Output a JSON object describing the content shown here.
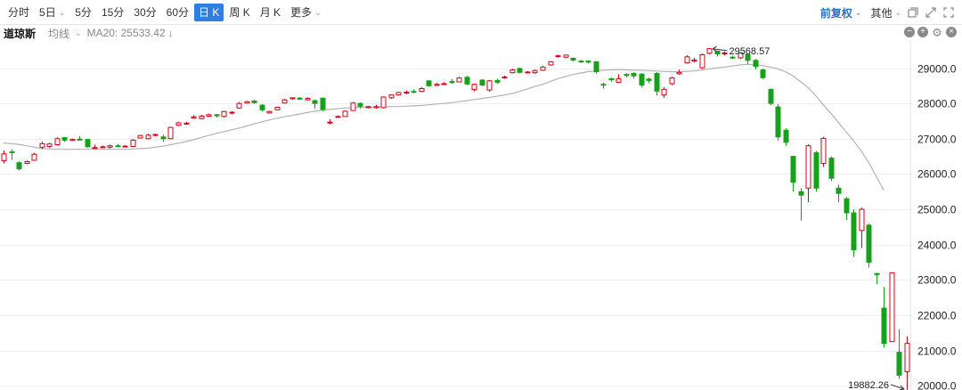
{
  "toolbar": {
    "tabs": [
      {
        "label": "分时",
        "dropdown": false,
        "active": false
      },
      {
        "label": "5日",
        "dropdown": true,
        "active": false
      },
      {
        "label": "5分",
        "dropdown": false,
        "active": false
      },
      {
        "label": "15分",
        "dropdown": false,
        "active": false
      },
      {
        "label": "30分",
        "dropdown": false,
        "active": false
      },
      {
        "label": "60分",
        "dropdown": false,
        "active": false
      },
      {
        "label": "日 K",
        "dropdown": false,
        "active": true
      },
      {
        "label": "周 K",
        "dropdown": false,
        "active": false
      },
      {
        "label": "月 K",
        "dropdown": false,
        "active": false
      },
      {
        "label": "更多",
        "dropdown": true,
        "active": false
      }
    ],
    "adjust_label": "前复权",
    "other_label": "其他"
  },
  "info": {
    "symbol": "道琼斯",
    "ma_label": "均线",
    "ma20_text": "MA20: 25533.42",
    "ma20_arrow": "↓"
  },
  "chart_data": {
    "type": "candlestick",
    "series_name": "道琼斯",
    "y_ticks": [
      "29000.0",
      "28000.0",
      "27000.0",
      "26000.0",
      "25000.0",
      "24000.0",
      "23000.0",
      "22000.0",
      "21000.0",
      "20000.0"
    ],
    "ylim": [
      19880,
      29770
    ],
    "annotations": {
      "high": "29568.57",
      "low": "19882.26"
    },
    "colors": {
      "up": "#d0021b",
      "down": "#17a01b",
      "ma": "#b3b3b3"
    },
    "candles": [
      [
        26380,
        26570,
        26670,
        26300
      ],
      [
        26630,
        26620,
        26700,
        26400
      ],
      [
        26320,
        26150,
        26360,
        26100
      ],
      [
        26300,
        26350,
        26380,
        26280
      ],
      [
        26390,
        26560,
        26600,
        26380
      ],
      [
        26760,
        26860,
        26920,
        26700
      ],
      [
        26780,
        26850,
        26880,
        26740
      ],
      [
        26830,
        27000,
        27040,
        26800
      ],
      [
        27030,
        26960,
        27050,
        26920
      ],
      [
        26950,
        26980,
        27000,
        26940
      ],
      [
        26990,
        26960,
        27080,
        26940
      ],
      [
        26980,
        26770,
        26990,
        26750
      ],
      [
        26740,
        26750,
        26830,
        26730
      ],
      [
        26750,
        26770,
        26810,
        26740
      ],
      [
        26760,
        26800,
        26830,
        26720
      ],
      [
        26800,
        26780,
        26850,
        26760
      ],
      [
        26780,
        26790,
        26820,
        26760
      ],
      [
        26780,
        26960,
        26990,
        26770
      ],
      [
        27020,
        27090,
        27110,
        27000
      ],
      [
        27000,
        27100,
        27140,
        26990
      ],
      [
        27100,
        27120,
        27140,
        27070
      ],
      [
        27050,
        27000,
        27110,
        26920
      ],
      [
        27000,
        27320,
        27340,
        26990
      ],
      [
        27380,
        27450,
        27480,
        27360
      ],
      [
        27430,
        27440,
        27480,
        27400
      ],
      [
        27590,
        27620,
        27670,
        27570
      ],
      [
        27570,
        27640,
        27680,
        27550
      ],
      [
        27640,
        27680,
        27710,
        27620
      ],
      [
        27680,
        27650,
        27700,
        27600
      ],
      [
        27630,
        27770,
        27790,
        27600
      ],
      [
        27740,
        27750,
        27780,
        27690
      ],
      [
        27870,
        28000,
        28040,
        27850
      ],
      [
        28010,
        28050,
        28070,
        27990
      ],
      [
        28070,
        28020,
        28110,
        27990
      ],
      [
        27950,
        27820,
        27980,
        27770
      ],
      [
        27730,
        27770,
        27790,
        27710
      ],
      [
        27820,
        27890,
        27910,
        27800
      ],
      [
        28010,
        28100,
        28130,
        27990
      ],
      [
        28130,
        28160,
        28170,
        28100
      ],
      [
        28150,
        28120,
        28180,
        28100
      ],
      [
        28100,
        28140,
        28170,
        28090
      ],
      [
        28080,
        28000,
        28110,
        27850
      ],
      [
        28150,
        27830,
        28160,
        27780
      ],
      [
        27470,
        27470,
        27550,
        27400
      ],
      [
        27620,
        27630,
        27660,
        27590
      ],
      [
        27630,
        27780,
        27800,
        27620
      ],
      [
        27800,
        28010,
        28040,
        27790
      ],
      [
        28000,
        27920,
        28030,
        27860
      ],
      [
        27880,
        27910,
        27930,
        27860
      ],
      [
        27880,
        27910,
        27960,
        27850
      ],
      [
        27880,
        28180,
        28200,
        27860
      ],
      [
        28160,
        28240,
        28260,
        28130
      ],
      [
        28240,
        28310,
        28330,
        28220
      ],
      [
        28300,
        28320,
        28370,
        28260
      ],
      [
        28340,
        28330,
        28400,
        28290
      ],
      [
        28340,
        28420,
        28460,
        28320
      ],
      [
        28640,
        28500,
        28650,
        28480
      ],
      [
        28510,
        28540,
        28580,
        28500
      ],
      [
        28540,
        28560,
        28600,
        28520
      ],
      [
        28620,
        28610,
        28690,
        28550
      ],
      [
        28610,
        28720,
        28750,
        28600
      ],
      [
        28740,
        28550,
        28780,
        28520
      ],
      [
        28390,
        28540,
        28560,
        28340
      ],
      [
        28660,
        28520,
        28690,
        28490
      ],
      [
        28380,
        28640,
        28660,
        28330
      ],
      [
        28650,
        28600,
        28700,
        28560
      ],
      [
        28730,
        28750,
        28790,
        28700
      ],
      [
        28870,
        28950,
        28980,
        28850
      ],
      [
        28990,
        28880,
        29010,
        28850
      ],
      [
        28880,
        28890,
        28920,
        28860
      ],
      [
        28870,
        28930,
        28960,
        28840
      ],
      [
        28940,
        29030,
        29070,
        28920
      ],
      [
        29090,
        29180,
        29200,
        29070
      ],
      [
        29330,
        29350,
        29380,
        29300
      ],
      [
        29310,
        29370,
        29380,
        29290
      ],
      [
        29280,
        29230,
        29300,
        29190
      ],
      [
        29200,
        29180,
        29230,
        29150
      ],
      [
        29200,
        29170,
        29220,
        29140
      ],
      [
        29180,
        28900,
        29200,
        28850
      ],
      [
        28540,
        28530,
        28590,
        28420
      ],
      [
        28700,
        28670,
        28730,
        28620
      ],
      [
        28600,
        28700,
        28830,
        28590
      ],
      [
        28820,
        28810,
        28860,
        28740
      ],
      [
        28850,
        28780,
        28880,
        28700
      ],
      [
        28830,
        28520,
        28860,
        28450
      ],
      [
        28690,
        28650,
        28730,
        28580
      ],
      [
        28850,
        28350,
        28880,
        28220
      ],
      [
        28240,
        28400,
        28460,
        28160
      ],
      [
        28560,
        28720,
        28750,
        28520
      ],
      [
        28840,
        28880,
        28960,
        28810
      ],
      [
        29150,
        29320,
        29370,
        29130
      ],
      [
        29200,
        29230,
        29290,
        29160
      ],
      [
        29010,
        29380,
        29410,
        28980
      ],
      [
        29420,
        29550,
        29570,
        29390
      ],
      [
        29480,
        29400,
        29500,
        29330
      ],
      [
        29420,
        29430,
        29470,
        29360
      ],
      [
        29310,
        29300,
        29360,
        29260
      ],
      [
        29290,
        29430,
        29450,
        29260
      ],
      [
        29390,
        29220,
        29400,
        29100
      ],
      [
        29220,
        29050,
        29260,
        28960
      ],
      [
        28950,
        28730,
        28990,
        28690
      ],
      [
        28400,
        28000,
        28420,
        27950
      ],
      [
        27900,
        27050,
        27980,
        26950
      ],
      [
        27240,
        26900,
        27300,
        26800
      ],
      [
        26500,
        25770,
        26520,
        25500
      ],
      [
        25500,
        25400,
        25600,
        24680
      ],
      [
        25600,
        26800,
        26840,
        25200
      ],
      [
        26600,
        25600,
        26650,
        25500
      ],
      [
        26300,
        27010,
        27050,
        26200
      ],
      [
        26450,
        25880,
        26500,
        25800
      ],
      [
        25600,
        25450,
        25700,
        25200
      ],
      [
        25300,
        24900,
        25350,
        24700
      ],
      [
        24900,
        23850,
        25000,
        23650
      ],
      [
        24400,
        25000,
        25050,
        23900
      ],
      [
        24550,
        23500,
        24600,
        23350
      ],
      [
        23180,
        23150,
        23200,
        22880
      ],
      [
        22200,
        21200,
        22800,
        21080
      ],
      [
        21250,
        23200,
        23200,
        21400
      ],
      [
        20950,
        20300,
        21600,
        20200
      ],
      [
        20400,
        21200,
        21400,
        19882
      ]
    ],
    "ma20": [
      26880,
      26860,
      26840,
      26800,
      26760,
      26720,
      26710,
      26700,
      26700,
      26700,
      26700,
      26700,
      26700,
      26700,
      26700,
      26700,
      26700,
      26710,
      26720,
      26730,
      26760,
      26790,
      26830,
      26870,
      26920,
      26970,
      27030,
      27090,
      27150,
      27200,
      27250,
      27300,
      27360,
      27420,
      27480,
      27530,
      27580,
      27620,
      27660,
      27700,
      27740,
      27780,
      27810,
      27830,
      27850,
      27870,
      27880,
      27890,
      27890,
      27900,
      27900,
      27910,
      27910,
      27920,
      27930,
      27940,
      27960,
      27980,
      28000,
      28020,
      28050,
      28080,
      28110,
      28140,
      28170,
      28200,
      28240,
      28280,
      28340,
      28410,
      28480,
      28540,
      28620,
      28700,
      28760,
      28820,
      28860,
      28900,
      28920,
      28940,
      28950,
      28960,
      28950,
      28940,
      28940,
      28930,
      28920,
      28910,
      28900,
      28900,
      28910,
      28920,
      28950,
      28980,
      29010,
      29030,
      29060,
      29090,
      29110,
      29100,
      29070,
      29030,
      28980,
      28900,
      28780,
      28620,
      28450,
      28220,
      27960,
      27720,
      27460,
      27200,
      26940,
      26650,
      26320,
      25920,
      25533
    ]
  }
}
